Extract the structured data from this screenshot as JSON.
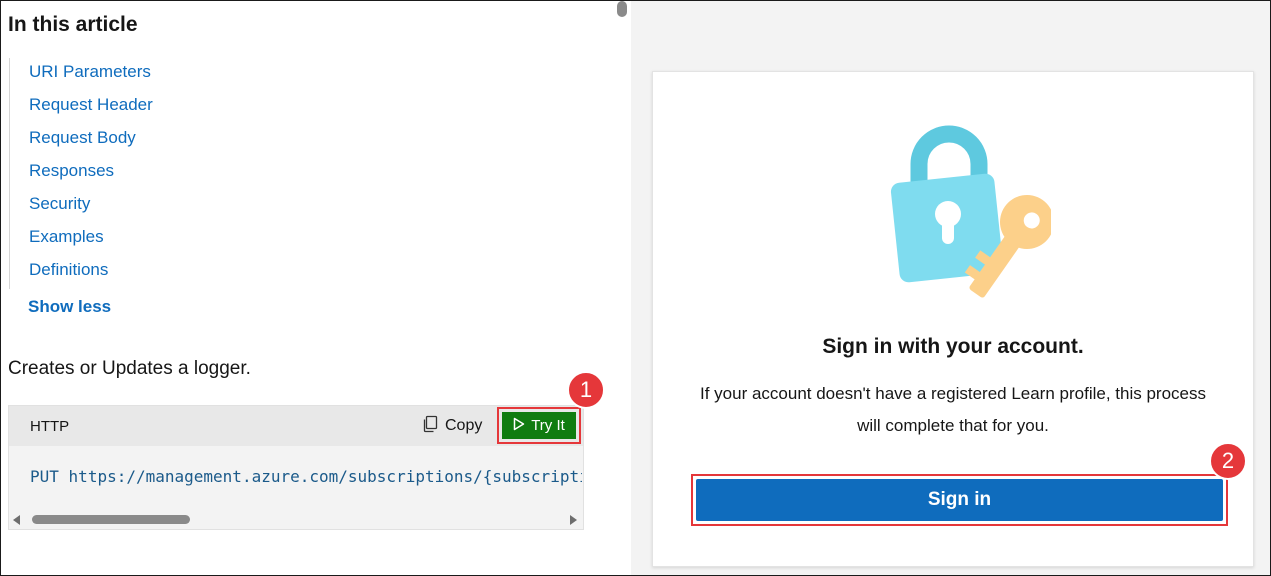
{
  "left": {
    "toc_title": "In this article",
    "toc_items": [
      {
        "label": "URI Parameters"
      },
      {
        "label": "Request Header"
      },
      {
        "label": "Request Body"
      },
      {
        "label": "Responses"
      },
      {
        "label": "Security"
      },
      {
        "label": "Examples"
      },
      {
        "label": "Definitions"
      }
    ],
    "show_less": "Show less",
    "description": "Creates or Updates a logger.",
    "code": {
      "language": "HTTP",
      "copy_label": "Copy",
      "try_label": "Try It",
      "method": "PUT",
      "url": "https://management.azure.com/subscriptions/{subscriptionId}/resourceGroups/{resourceGroupName}/providers/Microsoft.ApiManagement/service/{serviceName}/loggers/{loggerId}?api-version=2022-08-01"
    }
  },
  "badges": {
    "first": "1",
    "second": "2"
  },
  "right": {
    "title": "Sign in with your account.",
    "message": "If your account doesn't have a registered Learn profile, this process will complete that for you.",
    "signin_label": "Sign in"
  },
  "icons": {
    "copy": "copy-icon",
    "play": "play-icon",
    "illustration": "lock-key-icon"
  },
  "colors": {
    "link": "#0f6cbd",
    "try_button": "#107c10",
    "signin_button": "#0f6cbd",
    "highlight": "#e5373a"
  }
}
